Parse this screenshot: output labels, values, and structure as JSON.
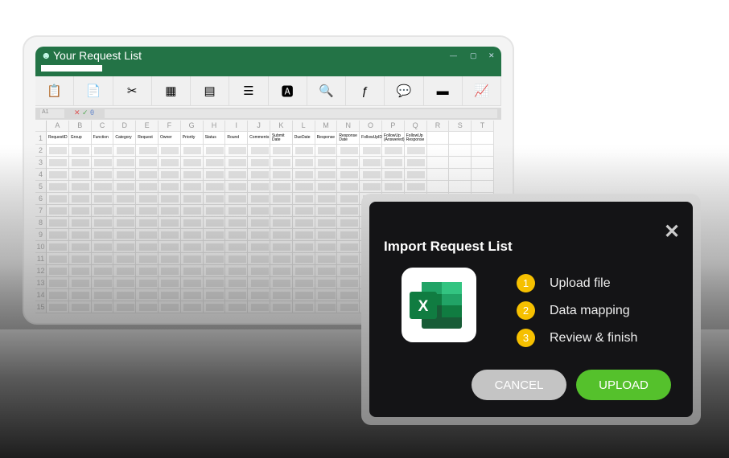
{
  "window": {
    "title": "Your Request List",
    "search_placeholder": "",
    "cell_ref": "A1"
  },
  "ribbon_icons": [
    "paste-icon",
    "copy-icon",
    "cut-format-painter-icon",
    "cell-styles-icon",
    "table-icon",
    "text-box-icon",
    "font-book-icon",
    "search-book-icon",
    "function-book-icon",
    "comment-add-icon",
    "bars-icon",
    "chart-icon"
  ],
  "columns": [
    "A",
    "B",
    "C",
    "D",
    "E",
    "F",
    "G",
    "H",
    "I",
    "J",
    "K",
    "L",
    "M",
    "N",
    "O",
    "P",
    "Q",
    "R",
    "S",
    "T"
  ],
  "headers": [
    "RequestID",
    "Group",
    "Function",
    "Category",
    "Request",
    "Owner",
    "Priority",
    "Status",
    "Round",
    "Comments",
    "Submit Date",
    "DueDate",
    "Response",
    "Response Date",
    "FollowUpID",
    "FollowUp (Answered)",
    "FollowUp Response",
    "",
    "",
    ""
  ],
  "rows": [
    "1",
    "2",
    "3",
    "4",
    "5",
    "6",
    "7",
    "8",
    "9",
    "10",
    "11",
    "12",
    "13",
    "14",
    "15"
  ],
  "dialog": {
    "title": "Import Request List",
    "steps": [
      {
        "n": "1",
        "label": "Upload file"
      },
      {
        "n": "2",
        "label": "Data mapping"
      },
      {
        "n": "3",
        "label": "Review & finish"
      }
    ],
    "cancel": "CANCEL",
    "upload": "UPLOAD"
  },
  "colors": {
    "excel_green": "#237346",
    "step_badge": "#f6c000",
    "upload": "#55c12c",
    "cancel": "#c4c4c4"
  }
}
